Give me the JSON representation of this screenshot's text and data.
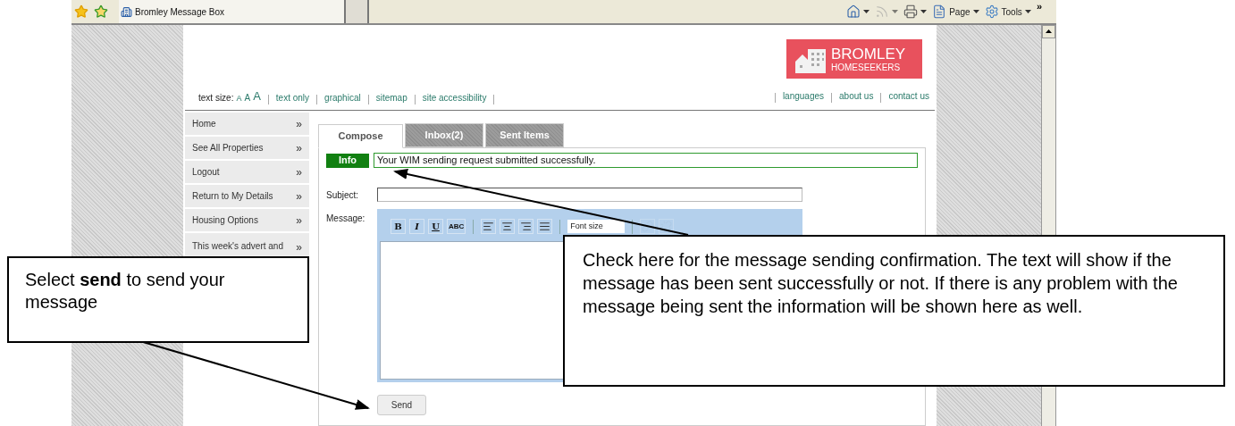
{
  "browser": {
    "tab_title": "Bromley Message Box",
    "toolbar": [
      {
        "kind": "home",
        "disabled": false
      },
      {
        "kind": "feed",
        "disabled": true
      },
      {
        "kind": "print",
        "disabled": false
      },
      {
        "kind": "page",
        "label": "Page",
        "disabled": false
      },
      {
        "kind": "tools",
        "label": "Tools",
        "disabled": false
      }
    ],
    "overflow": "»"
  },
  "header": {
    "logo": {
      "line1": "BROMLEY",
      "line2": "HOMESEEKERS"
    },
    "text_size_label": "text size:",
    "text_size_options": [
      "A",
      "A",
      "A"
    ],
    "links_left": [
      "text only",
      "graphical",
      "sitemap",
      "site accessibility"
    ],
    "links_right": [
      "languages",
      "about us",
      "contact us"
    ]
  },
  "sidebar": {
    "items": [
      {
        "label": "Home",
        "chevron": "»"
      },
      {
        "label": "See All Properties",
        "chevron": "»"
      },
      {
        "label": "Logout",
        "chevron": "»"
      },
      {
        "label": "Return to My Details",
        "chevron": "»"
      },
      {
        "label": "Housing Options",
        "chevron": "»"
      },
      {
        "label": "This week's advert and",
        "chevron": "»"
      }
    ]
  },
  "tabs": [
    {
      "label": "Compose",
      "selected": true
    },
    {
      "label": "Inbox(2)",
      "selected": false
    },
    {
      "label": "Sent Items",
      "selected": false
    }
  ],
  "info": {
    "badge": "Info",
    "message": "Your WIM sending request submitted successfully."
  },
  "form": {
    "subject_label": "Subject:",
    "message_label": "Message:",
    "editor_toolbar": [
      {
        "buttons": [
          {
            "kind": "text",
            "label": "B",
            "disabled": false
          },
          {
            "kind": "text",
            "label": "I",
            "disabled": false
          },
          {
            "kind": "text",
            "label": "U",
            "disabled": false
          },
          {
            "kind": "text",
            "label": "ABC",
            "disabled": false
          }
        ]
      },
      {
        "buttons": [
          {
            "kind": "align-left",
            "disabled": false
          },
          {
            "kind": "align-center",
            "disabled": false
          },
          {
            "kind": "align-right",
            "disabled": false
          },
          {
            "kind": "align-justify",
            "disabled": false
          }
        ]
      },
      {
        "buttons": [
          {
            "kind": "select",
            "label": "Font size",
            "disabled": false
          }
        ]
      },
      {
        "buttons": [
          {
            "kind": "link",
            "disabled": true
          },
          {
            "kind": "unlink",
            "disabled": true
          }
        ]
      }
    ],
    "send_button": "Send"
  },
  "callouts": [
    {
      "text": "Select **send** to send your message"
    },
    {
      "text": "Check here for the message sending confirmation. The text will show if the message has been sent successfully or not. If there is any problem with the message being sent the information will be shown here as well."
    }
  ]
}
